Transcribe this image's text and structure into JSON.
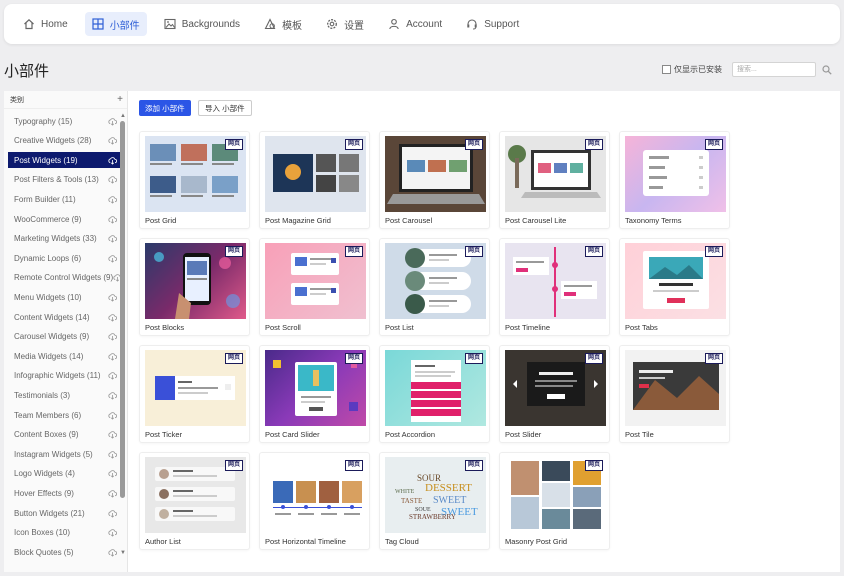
{
  "nav": {
    "items": [
      {
        "label": "Home",
        "icon": "home-icon"
      },
      {
        "label": "小部件",
        "icon": "widgets-icon",
        "active": true
      },
      {
        "label": "Backgrounds",
        "icon": "image-icon"
      },
      {
        "label": "模板",
        "icon": "templates-icon"
      },
      {
        "label": "设置",
        "icon": "gear-icon"
      },
      {
        "label": "Account",
        "icon": "user-icon"
      },
      {
        "label": "Support",
        "icon": "headset-icon"
      }
    ]
  },
  "page": {
    "title": "小部件"
  },
  "toolbar": {
    "installed_only_label": "仅显示已安装",
    "search_placeholder": "搜索..."
  },
  "sidebar": {
    "header": "类别",
    "categories": [
      {
        "label": "Typography (15)"
      },
      {
        "label": "Creative Widgets (28)"
      },
      {
        "label": "Post Widgets (19)",
        "active": true
      },
      {
        "label": "Post Filters & Tools (13)"
      },
      {
        "label": "Form Builder (11)"
      },
      {
        "label": "WooCommerce (9)"
      },
      {
        "label": "Marketing Widgets (33)"
      },
      {
        "label": "Dynamic Loops (6)"
      },
      {
        "label": "Remote Control Widgets (9)"
      },
      {
        "label": "Menu Widgets (10)"
      },
      {
        "label": "Content Widgets (14)"
      },
      {
        "label": "Carousel Widgets (9)"
      },
      {
        "label": "Media Widgets (14)"
      },
      {
        "label": "Infographic Widgets (11)"
      },
      {
        "label": "Testimonials (3)"
      },
      {
        "label": "Team Members (6)"
      },
      {
        "label": "Content Boxes (9)"
      },
      {
        "label": "Instagram Widgets (5)"
      },
      {
        "label": "Logo Widgets (4)"
      },
      {
        "label": "Hover Effects (9)"
      },
      {
        "label": "Button Widgets (21)"
      },
      {
        "label": "Icon Boxes (10)"
      },
      {
        "label": "Block Quotes (5)"
      }
    ]
  },
  "actions": {
    "add_label": "添加 小部件",
    "import_label": "导入 小部件"
  },
  "badge_label": "网页",
  "widgets": [
    {
      "label": "Post Grid"
    },
    {
      "label": "Post Magazine Grid"
    },
    {
      "label": "Post Carousel"
    },
    {
      "label": "Post Carousel Lite"
    },
    {
      "label": "Taxonomy Terms"
    },
    {
      "label": "Post Blocks"
    },
    {
      "label": "Post Scroll"
    },
    {
      "label": "Post List"
    },
    {
      "label": "Post Timeline"
    },
    {
      "label": "Post Tabs"
    },
    {
      "label": "Post Ticker"
    },
    {
      "label": "Post Card Slider"
    },
    {
      "label": "Post Accordion"
    },
    {
      "label": "Post Slider"
    },
    {
      "label": "Post Tile"
    },
    {
      "label": "Author List"
    },
    {
      "label": "Post Horizontal Timeline"
    },
    {
      "label": "Tag Cloud"
    },
    {
      "label": "Masonry Post Grid"
    }
  ],
  "colors": {
    "accent": "#2b55e6",
    "sidebar_active": "#0d1a6e",
    "nav_active_bg": "#e8eefc",
    "badge": "#1b1b5a"
  }
}
